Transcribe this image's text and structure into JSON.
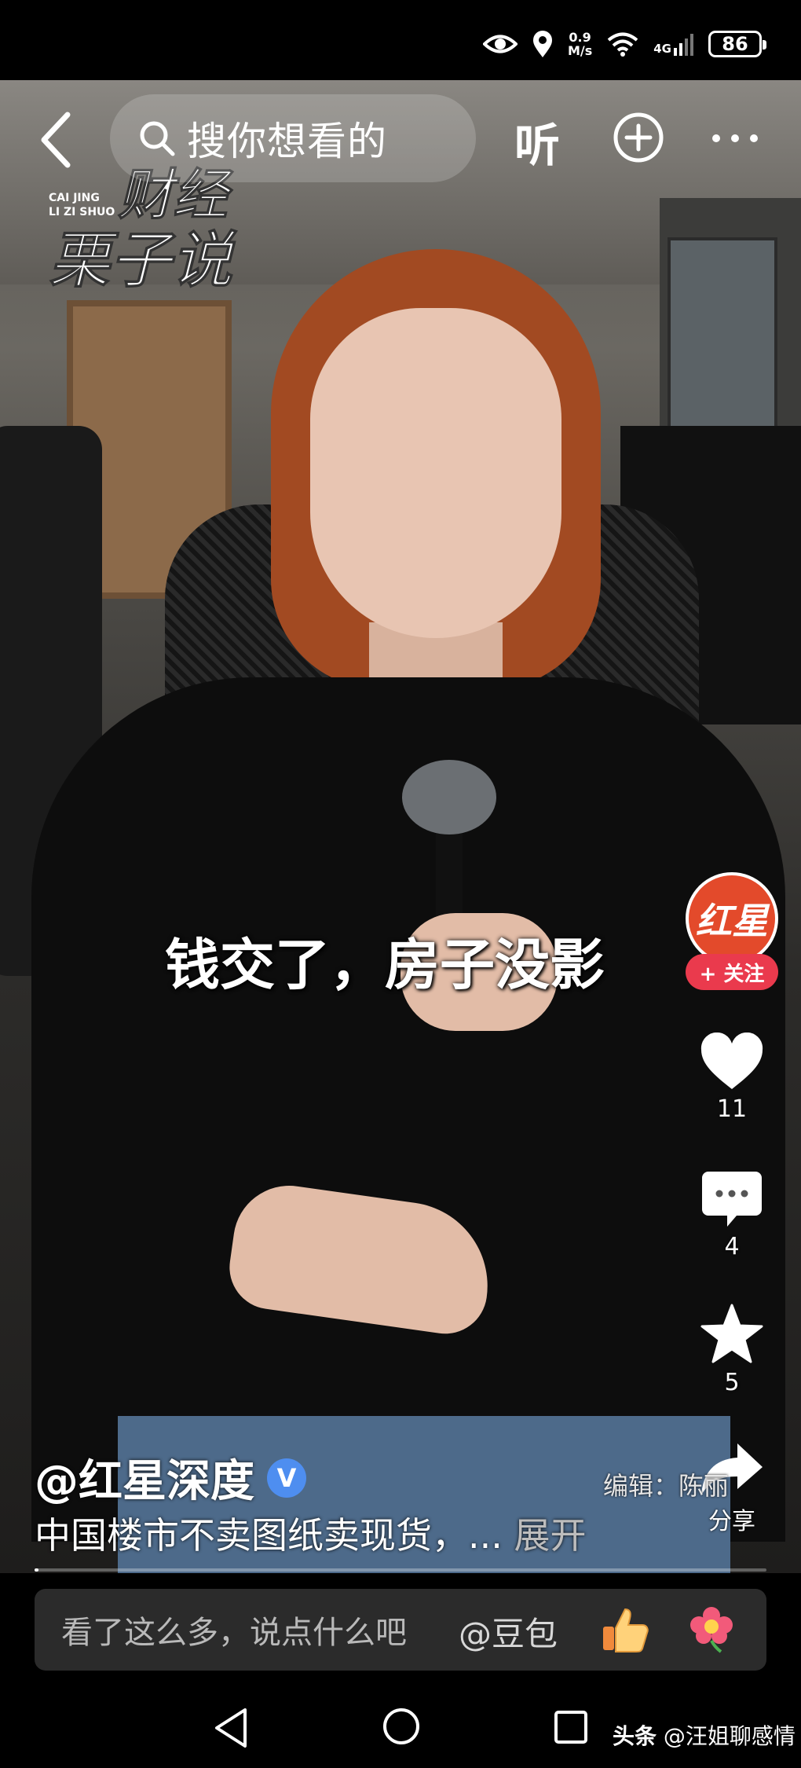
{
  "status_bar": {
    "net_speed_value": "0.9",
    "net_speed_unit": "M/s",
    "network": "4G",
    "battery": "86"
  },
  "top_nav": {
    "search_placeholder": "搜你想看的",
    "listen_label": "听"
  },
  "logo": {
    "line1_small": "CAI JING",
    "line2_small": "LI ZI SHUO",
    "title_top": "财经",
    "title_bottom": "栗子说"
  },
  "video": {
    "subtitle": "钱交了，房子没影",
    "progress_fraction": 0.005
  },
  "right_rail": {
    "avatar_text": "红星",
    "follow_label": "+ 关注",
    "like_count": "11",
    "comment_count": "4",
    "favorite_count": "5",
    "share_label": "分享"
  },
  "info": {
    "author": "@红星深度",
    "verified_badge": "V",
    "editor": "编辑：陈丽",
    "description": "中国楼市不卖图纸卖现货，... ",
    "expand_label": "展开"
  },
  "comment_bar": {
    "placeholder": "看了这么多，说点什么吧",
    "mention": "@豆包"
  },
  "nav_bar": {
    "watermark_app": "头条",
    "watermark_user": "@汪姐聊感情"
  },
  "colors": {
    "follow_red": "#ea3a4d",
    "avatar_red": "#e34a2b",
    "verified_blue": "#4e8ef0"
  }
}
